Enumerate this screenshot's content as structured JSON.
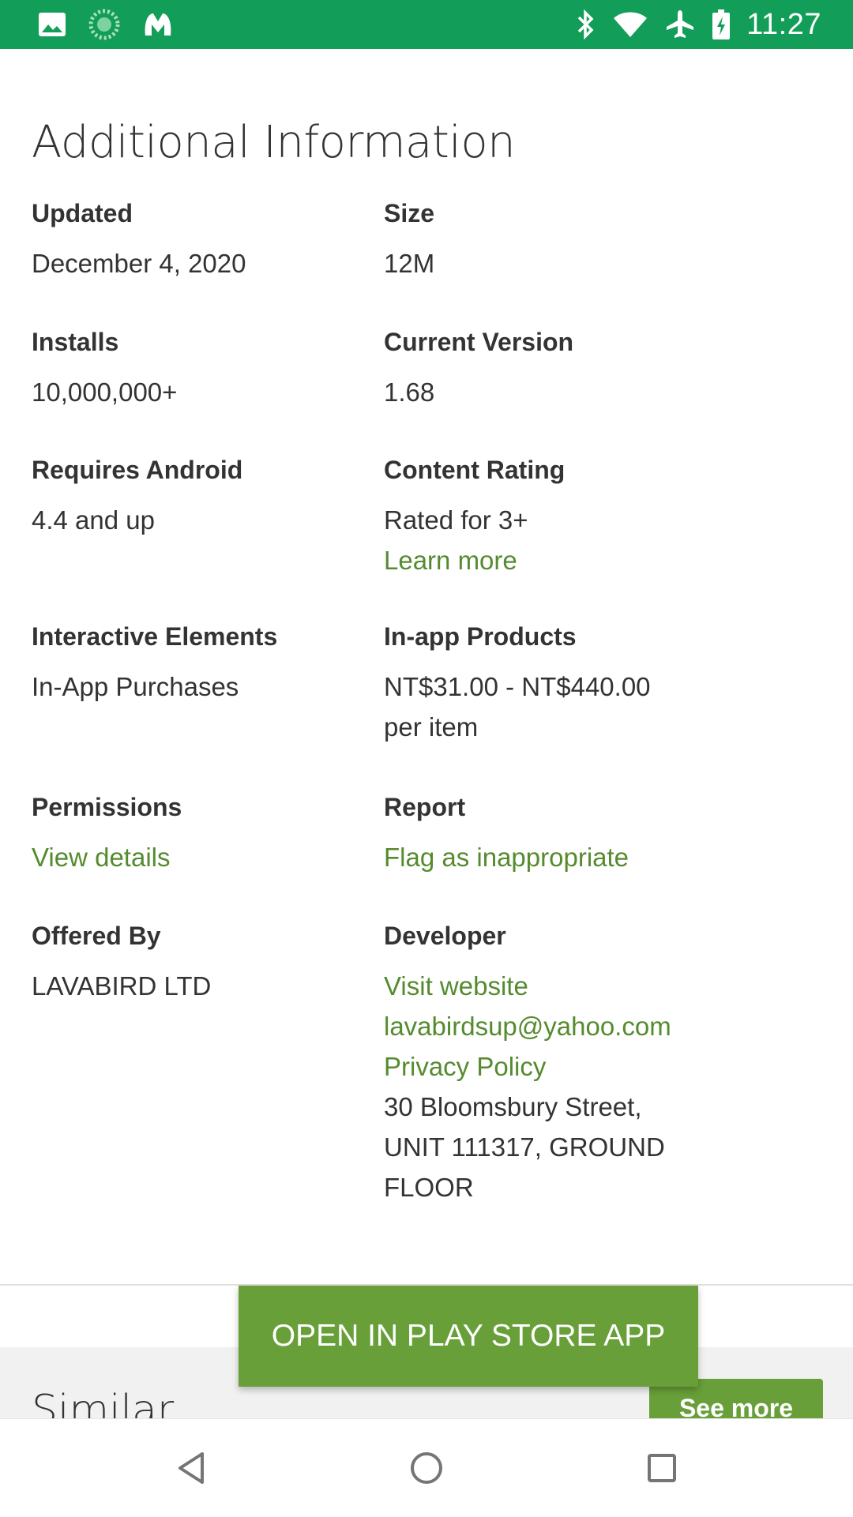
{
  "status_bar": {
    "time": "11:27",
    "left_icons": [
      "image-icon",
      "spinner-icon",
      "malwarebytes-icon"
    ],
    "right_icons": [
      "bluetooth-icon",
      "wifi-icon",
      "airplane-icon",
      "battery-charging-icon"
    ]
  },
  "section": {
    "title": "Additional Information"
  },
  "info": {
    "updated": {
      "label": "Updated",
      "value": "December 4, 2020"
    },
    "size": {
      "label": "Size",
      "value": "12M"
    },
    "installs": {
      "label": "Installs",
      "value": "10,000,000+"
    },
    "current_version": {
      "label": "Current Version",
      "value": "1.68"
    },
    "requires_android": {
      "label": "Requires Android",
      "value": "4.4 and up"
    },
    "content_rating": {
      "label": "Content Rating",
      "value": "Rated for 3+",
      "link": "Learn more"
    },
    "interactive_elements": {
      "label": "Interactive Elements",
      "value": "In-App Purchases"
    },
    "in_app_products": {
      "label": "In-app Products",
      "value_line1": "NT$31.00 - NT$440.00",
      "value_line2": "per item"
    },
    "permissions": {
      "label": "Permissions",
      "link": "View details"
    },
    "report": {
      "label": "Report",
      "link": "Flag as inappropriate"
    },
    "offered_by": {
      "label": "Offered By",
      "value": "LAVABIRD LTD"
    },
    "developer": {
      "label": "Developer",
      "website_link": "Visit website",
      "email_link": "lavabirdsup@yahoo.com",
      "privacy_link": "Privacy Policy",
      "address_line1": "30 Bloomsbury Street,",
      "address_line2": "UNIT 111317, GROUND",
      "address_line3": "FLOOR"
    }
  },
  "similar": {
    "title": "Similar",
    "see_more": "See more"
  },
  "open_store_button": "OPEN IN PLAY STORE APP",
  "nav": [
    "back-icon",
    "home-icon",
    "recents-icon"
  ],
  "colors": {
    "status_bar": "#129d58",
    "link": "#558b2f",
    "button": "#689f38"
  }
}
